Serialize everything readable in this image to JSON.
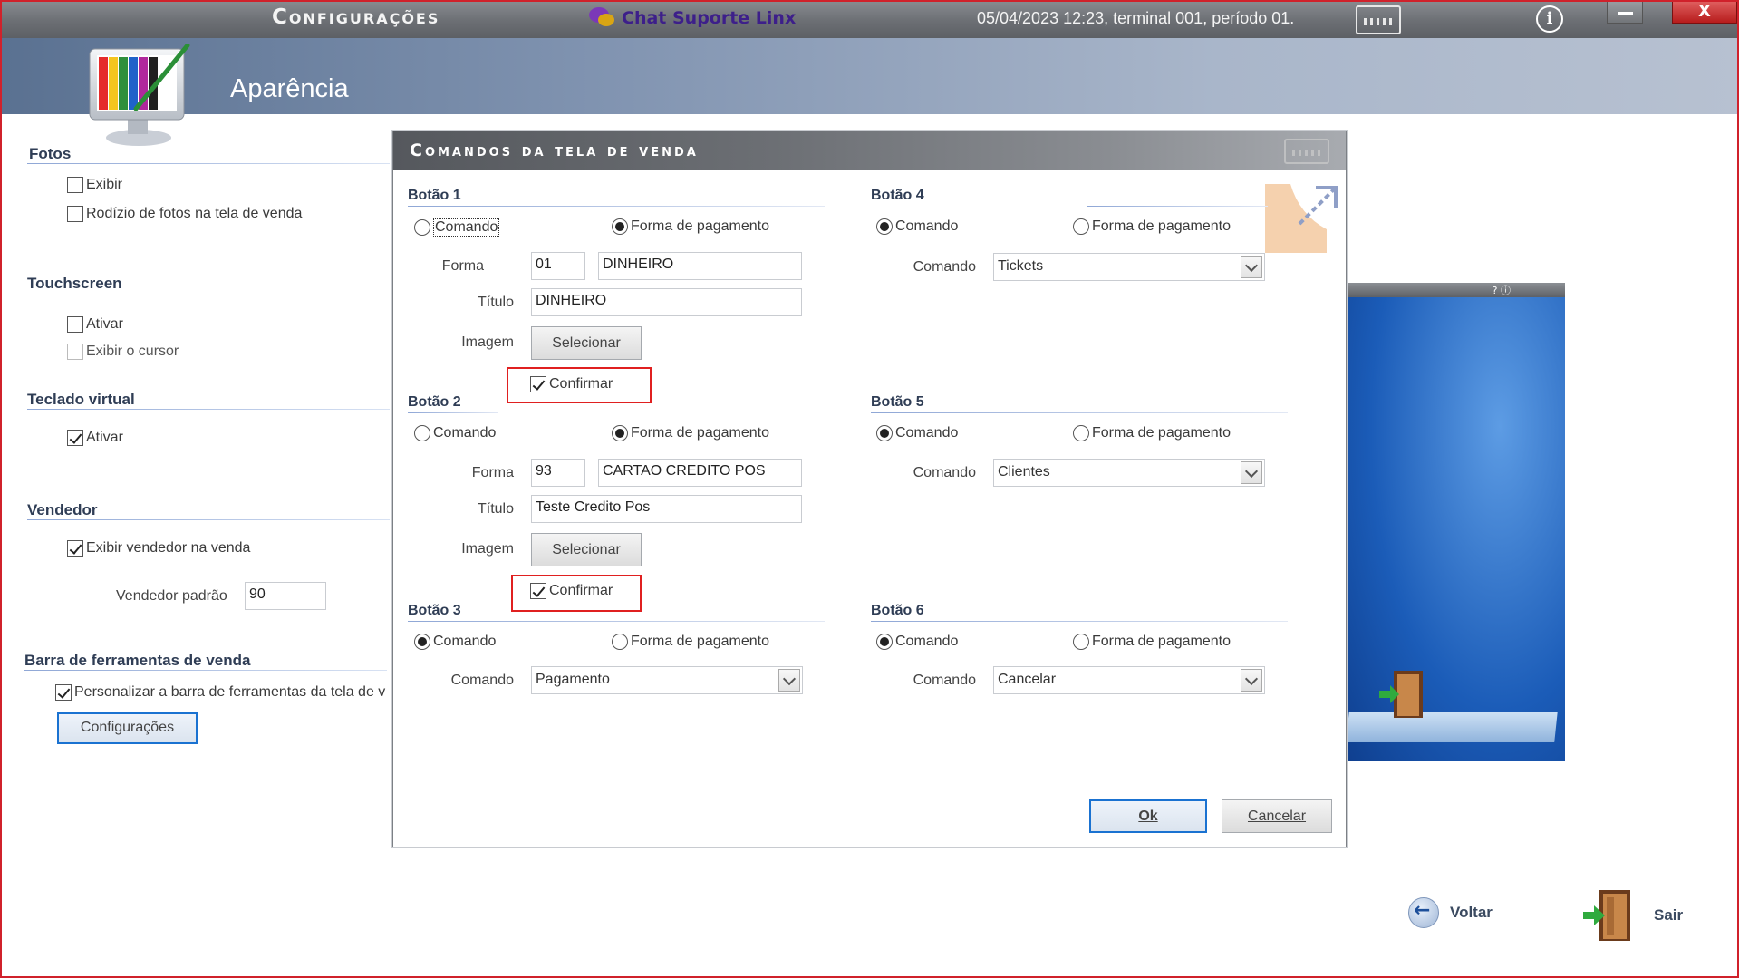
{
  "titlebar": {
    "title": "Configurações",
    "chat_label": "Chat Suporte Linx",
    "status": "05/04/2023 12:23, terminal 001, período 01.",
    "close_label": "X"
  },
  "page": {
    "title": "Aparência"
  },
  "left": {
    "fotos": {
      "title": "Fotos",
      "exibir": "Exibir",
      "rodizio": "Rodízio de fotos na tela de venda"
    },
    "touchscreen": {
      "title": "Touchscreen",
      "ativar": "Ativar",
      "exibir_cursor": "Exibir o cursor"
    },
    "teclado": {
      "title": "Teclado virtual",
      "ativar": "Ativar"
    },
    "vendedor": {
      "title": "Vendedor",
      "exibir": "Exibir vendedor na venda",
      "padrao_label": "Vendedor padrão",
      "padrao_value": "90"
    },
    "barra": {
      "title": "Barra de ferramentas de venda",
      "personalizar": "Personalizar a barra de ferramentas da tela de v",
      "config_button": "Configurações"
    }
  },
  "preview": {
    "bar_text": "? ⓘ"
  },
  "nav": {
    "voltar": "Voltar",
    "sair": "Sair"
  },
  "modal": {
    "title": "Comandos da tela de venda",
    "labels": {
      "comando": "Comando",
      "forma_pagamento": "Forma de pagamento",
      "forma": "Forma",
      "titulo": "Título",
      "imagem": "Imagem",
      "selecionar": "Selecionar",
      "confirmar": "Confirmar"
    },
    "botao1": {
      "title": "Botão 1",
      "forma_code": "01",
      "forma_name": "DINHEIRO",
      "titulo": "DINHEIRO"
    },
    "botao2": {
      "title": "Botão 2",
      "forma_code": "93",
      "forma_name": "CARTAO CREDITO POS",
      "titulo": "Teste Credito Pos"
    },
    "botao3": {
      "title": "Botão 3",
      "comando": "Pagamento"
    },
    "botao4": {
      "title": "Botão 4",
      "comando": "Tickets"
    },
    "botao5": {
      "title": "Botão 5",
      "comando": "Clientes"
    },
    "botao6": {
      "title": "Botão 6",
      "comando": "Cancelar"
    },
    "ok": "Ok",
    "cancelar": "Cancelar"
  },
  "colors": {
    "accent_blue": "#1a72d1",
    "highlight_red": "#e02020",
    "header_blue": "#8194b1"
  }
}
